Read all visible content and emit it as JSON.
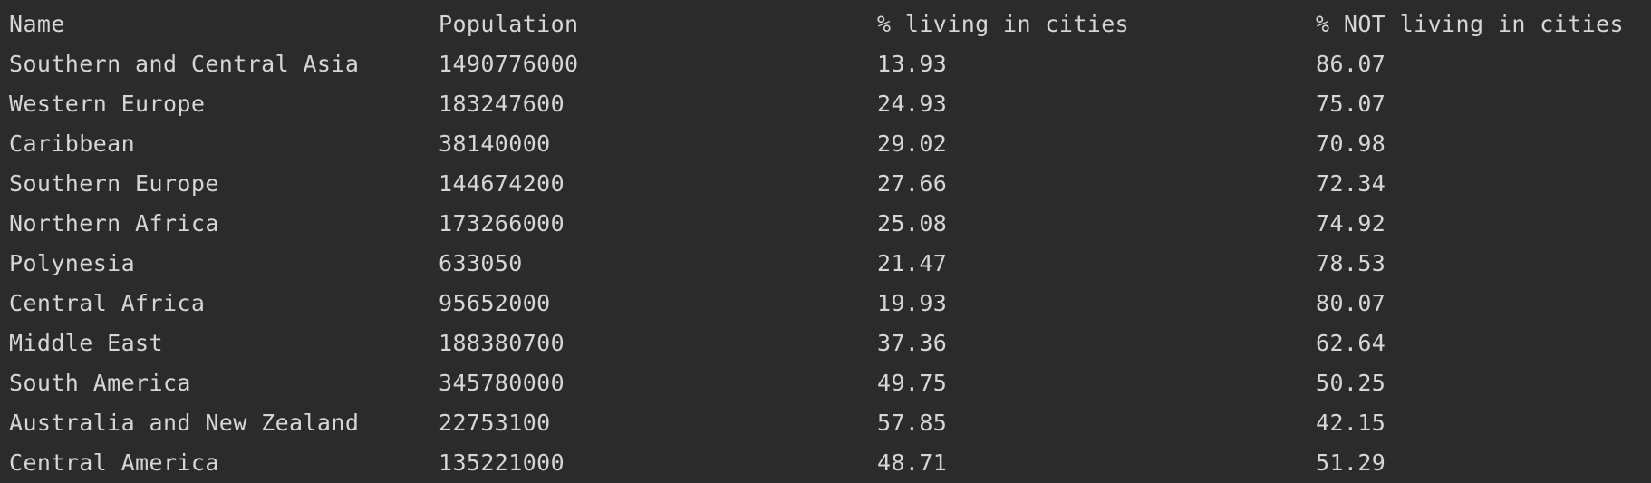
{
  "output": {
    "headers": [
      "Name",
      "Population",
      "% living in cities",
      "% NOT living in cities"
    ],
    "rows": [
      [
        "Southern and Central Asia",
        "1490776000",
        "13.93",
        "86.07"
      ],
      [
        "Western Europe",
        "183247600",
        "24.93",
        "75.07"
      ],
      [
        "Caribbean",
        "38140000",
        "29.02",
        "70.98"
      ],
      [
        "Southern Europe",
        "144674200",
        "27.66",
        "72.34"
      ],
      [
        "Northern Africa",
        "173266000",
        "25.08",
        "74.92"
      ],
      [
        "Polynesia",
        "633050",
        "21.47",
        "78.53"
      ],
      [
        "Central Africa",
        "95652000",
        "19.93",
        "80.07"
      ],
      [
        "Middle East",
        "188380700",
        "37.36",
        "62.64"
      ],
      [
        "South America",
        "345780000",
        "49.75",
        "50.25"
      ],
      [
        "Australia and New Zealand",
        "22753100",
        "57.85",
        "42.15"
      ],
      [
        "Central America",
        "135221000",
        "48.71",
        "51.29"
      ]
    ]
  },
  "colors": {
    "background": "#2b2b2b",
    "text": "#d6d6d6"
  }
}
